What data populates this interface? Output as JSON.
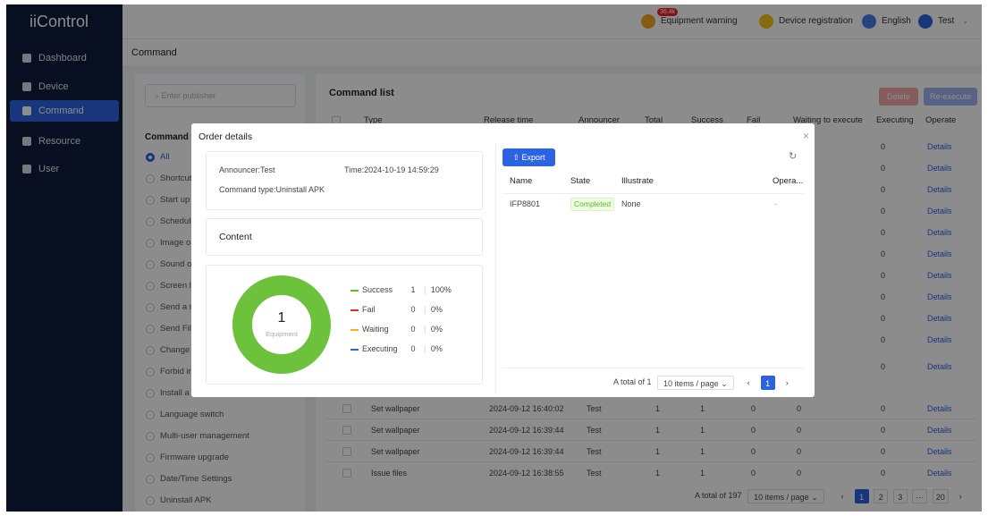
{
  "app": {
    "logo": "iiControl"
  },
  "sidebar": {
    "items": [
      {
        "label": "Dashboard",
        "icon": "dashboard-icon"
      },
      {
        "label": "Device",
        "icon": "device-icon"
      },
      {
        "label": "Command",
        "icon": "command-icon",
        "active": true
      },
      {
        "label": "Resource",
        "icon": "folder-icon"
      },
      {
        "label": "User",
        "icon": "user-icon"
      }
    ]
  },
  "header": {
    "warning_badge": "36.4k",
    "warning_label": "Equipment warning",
    "registration_label": "Device registration",
    "language_label": "English",
    "user_label": "Test"
  },
  "breadcrumb": "Command",
  "left_panel": {
    "search_placeholder": "Enter publisher",
    "heading_partial": "Command t",
    "types": [
      "All",
      "Shortcut",
      "Start up",
      "Schedule",
      "Image o",
      "Sound o",
      "Screen l",
      "Send a r",
      "Send File",
      "Change",
      "Forbid in",
      "Install a",
      "Language switch",
      "Multi-user management",
      "Firmware upgrade",
      "Date/Time Settings",
      "Uninstall APK"
    ]
  },
  "command_list": {
    "title": "Command list",
    "delete_label": "Delete",
    "reexecute_label": "Re-execute",
    "columns": [
      "Type",
      "Release time",
      "Announcer",
      "Total",
      "Success",
      "Fail",
      "Waiting to execute",
      "Executing",
      "Operate"
    ],
    "background_rows": [
      {
        "executing": "0",
        "operate": "Details"
      }
    ],
    "rows": [
      {
        "type": "Set wallpaper",
        "time": "2024-09-12 16:40:02",
        "announcer": "Test",
        "total": "1",
        "success": "1",
        "fail": "0",
        "waiting": "0",
        "executing": "0",
        "operate": "Details"
      },
      {
        "type": "Set wallpaper",
        "time": "2024-09-12 16:39:44",
        "announcer": "Test",
        "total": "1",
        "success": "1",
        "fail": "0",
        "waiting": "0",
        "executing": "0",
        "operate": "Details"
      },
      {
        "type": "Set wallpaper",
        "time": "2024-09-12 16:39:44",
        "announcer": "Test",
        "total": "1",
        "success": "1",
        "fail": "0",
        "waiting": "0",
        "executing": "0",
        "operate": "Details"
      },
      {
        "type": "Issue files",
        "time": "2024-09-12 16:38:55",
        "announcer": "Test",
        "total": "1",
        "success": "1",
        "fail": "0",
        "waiting": "0",
        "executing": "0",
        "operate": "Details"
      }
    ],
    "pagination": {
      "total_text": "A total of 197",
      "page_size": "10 items / page",
      "pages": [
        "1",
        "2",
        "3",
        "···",
        "20"
      ],
      "current": "1"
    }
  },
  "modal": {
    "title": "Order details",
    "close": "×",
    "announcer": "Announcer:Test",
    "time": "Time:2024-10-19 14:59:29",
    "command_type": "Command type:Uninstall APK",
    "content_label": "Content",
    "donut": {
      "count": "1",
      "label": "Equipment",
      "success_fraction": 1.0
    },
    "legend": [
      {
        "label": "Success",
        "count": "1",
        "pct": "100%",
        "color": "#52c41a"
      },
      {
        "label": "Fail",
        "count": "0",
        "pct": "0%",
        "color": "#f5222d"
      },
      {
        "label": "Waiting",
        "count": "0",
        "pct": "0%",
        "color": "#faad14"
      },
      {
        "label": "Executing",
        "count": "0",
        "pct": "0%",
        "color": "#2c63e0"
      }
    ],
    "export_label": "Export",
    "columns": [
      "Name",
      "State",
      "Illustrate",
      "Opera..."
    ],
    "rows": [
      {
        "name": "IFP8801",
        "state": "Completed",
        "illustrate": "None",
        "operate": "-"
      }
    ],
    "pagination": {
      "total_text": "A total of 1",
      "page_size": "10 items / page",
      "current": "1"
    }
  },
  "colors": {
    "accent": "#2c63e0",
    "sidebar_bg": "#0d1c3c",
    "success": "#52c41a",
    "warning": "#faad14",
    "danger": "#f5222d"
  }
}
